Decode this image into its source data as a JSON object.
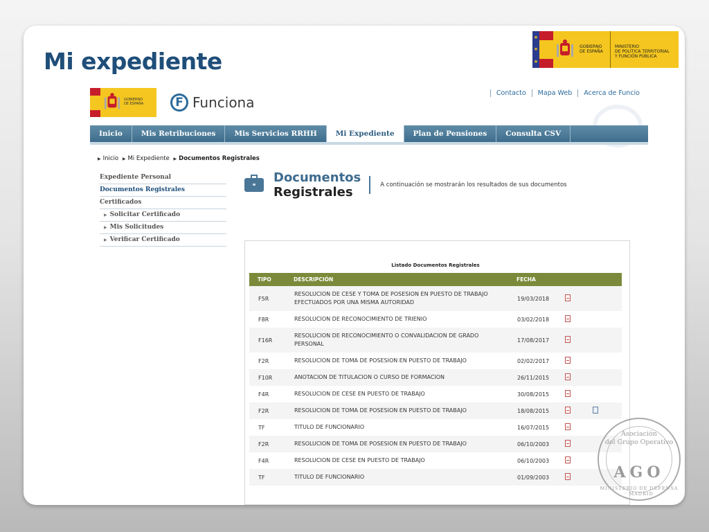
{
  "slide": {
    "title": "Mi expediente",
    "ministry_banner": {
      "line1": "GOBIERNO",
      "line2": "DE ESPAÑA",
      "ministry1": "MINISTERIO",
      "ministry2": "DE POLÍTICA TERRITORIAL",
      "ministry3": "Y FUNCIÓN PÚBLICA"
    }
  },
  "web": {
    "gov_logo": {
      "line1": "GOBIERNO",
      "line2": "DE ESPAÑA"
    },
    "brand": {
      "letter": "F",
      "name": "Funciona"
    },
    "toplinks": [
      "Contacto",
      "Mapa Web",
      "Acerca de Funcio"
    ],
    "nav": [
      "Inicio",
      "Mis Retribuciones",
      "Mis Servicios RRHH",
      "Mi Expediente",
      "Plan de Pensiones",
      "Consulta CSV"
    ],
    "nav_active_index": 3,
    "breadcrumb": {
      "items": [
        "Inicio",
        "Mi Expediente"
      ],
      "current": "Documentos Registrales"
    },
    "sidemenu": {
      "items": [
        "Expediente Personal",
        "Documentos Registrales",
        "Certificados"
      ],
      "subitems": [
        "Solicitar Certificado",
        "Mis Solicitudes",
        "Verificar Certificado"
      ]
    },
    "header": {
      "title_line1": "Documentos",
      "title_line2": "Registrales",
      "description": "A continuación se mostrarán los resultados de sus documentos"
    },
    "list": {
      "title": "Listado Documentos Registrales",
      "columns": {
        "tipo": "TIPO",
        "descripcion": "DESCRIPCIÓN",
        "fecha": "FECHA"
      },
      "rows": [
        {
          "tipo": "F5R",
          "descripcion": "RESOLUCION DE CESE Y TOMA DE POSESION EN PUESTO DE TRABAJO EFECTUADOS POR UNA MISMA AUTORIDAD",
          "fecha": "19/03/2018"
        },
        {
          "tipo": "F8R",
          "descripcion": "RESOLUCION DE RECONOCIMIENTO DE TRIENIO",
          "fecha": "03/02/2018"
        },
        {
          "tipo": "F16R",
          "descripcion": "RESOLUCION DE RECONOCIMIENTO O CONVALIDACION DE GRADO PERSONAL",
          "fecha": "17/08/2017"
        },
        {
          "tipo": "F2R",
          "descripcion": "RESOLUCION DE TOMA DE POSESION EN PUESTO DE TRABAJO",
          "fecha": "02/02/2017"
        },
        {
          "tipo": "F10R",
          "descripcion": "ANOTACION DE TITULACION O CURSO DE FORMACION",
          "fecha": "26/11/2015"
        },
        {
          "tipo": "F4R",
          "descripcion": "RESOLUCION DE CESE EN PUESTO DE TRABAJO",
          "fecha": "30/08/2015"
        },
        {
          "tipo": "F2R",
          "descripcion": "RESOLUCION DE TOMA DE POSESION EN PUESTO DE TRABAJO",
          "fecha": "18/08/2015"
        },
        {
          "tipo": "TF",
          "descripcion": "TITULO DE FUNCIONARIO",
          "fecha": "16/07/2015"
        },
        {
          "tipo": "F2R",
          "descripcion": "RESOLUCION DE TOMA DE POSESION EN PUESTO DE TRABAJO",
          "fecha": "06/10/2003"
        },
        {
          "tipo": "F4R",
          "descripcion": "RESOLUCION DE CESE EN PUESTO DE TRABAJO",
          "fecha": "06/10/2003"
        },
        {
          "tipo": "TF",
          "descripcion": "TITULO DE FUNCIONARIO",
          "fecha": "01/09/2003"
        }
      ]
    }
  },
  "seal": {
    "line1": "Asociación",
    "line2": "del Grupo Operativo",
    "acronym": "AGO",
    "ring_text": "MINISTERIO DE DEFENSA · MADRID"
  },
  "colors": {
    "slide_title": "#1f4e79",
    "nav_bar": "#3e6d8c",
    "table_header": "#7b8a3a",
    "banner_yellow": "#f4c61f"
  }
}
